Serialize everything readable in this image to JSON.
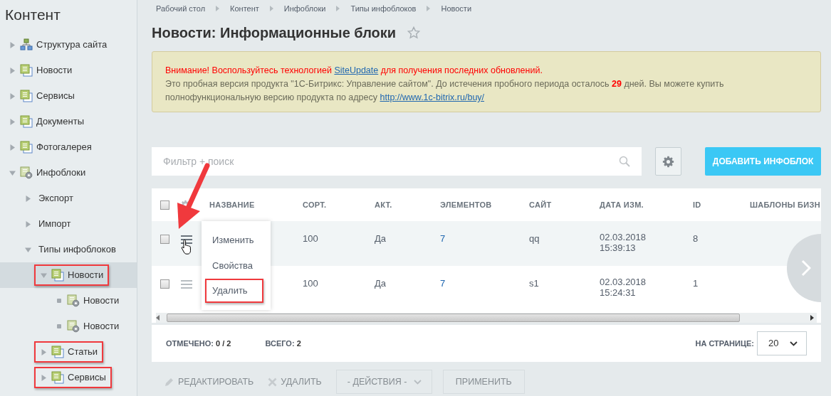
{
  "sidebar": {
    "title": "Контент",
    "items": [
      {
        "label": "Структура сайта",
        "kind": "structure",
        "expanded": false,
        "selected": false,
        "annotated": false
      },
      {
        "label": "Новости",
        "kind": "iblock",
        "expanded": false,
        "selected": false,
        "annotated": false
      },
      {
        "label": "Сервисы",
        "kind": "iblock",
        "expanded": false,
        "selected": false,
        "annotated": false
      },
      {
        "label": "Документы",
        "kind": "iblock",
        "expanded": false,
        "selected": false,
        "annotated": false
      },
      {
        "label": "Фотогалерея",
        "kind": "iblock",
        "expanded": false,
        "selected": false,
        "annotated": false
      },
      {
        "label": "Инфоблоки",
        "kind": "iblock-settings",
        "expanded": true,
        "selected": false,
        "annotated": false,
        "children": [
          {
            "label": "Экспорт",
            "kind": "plain",
            "expanded": false,
            "selected": false,
            "annotated": false
          },
          {
            "label": "Импорт",
            "kind": "plain",
            "expanded": false,
            "selected": false,
            "annotated": false
          },
          {
            "label": "Типы инфоблоков",
            "kind": "plain",
            "expanded": true,
            "selected": false,
            "annotated": false,
            "children": [
              {
                "label": "Новости",
                "kind": "iblock",
                "expanded": true,
                "selected": true,
                "annotated": true,
                "children": [
                  {
                    "label": "Новости",
                    "kind": "iblock-settings",
                    "selected": false,
                    "annotated": false
                  },
                  {
                    "label": "Новости",
                    "kind": "iblock-settings",
                    "selected": false,
                    "annotated": false
                  }
                ]
              },
              {
                "label": "Статьи",
                "kind": "iblock",
                "expanded": false,
                "selected": false,
                "annotated": true
              },
              {
                "label": "Сервисы",
                "kind": "iblock",
                "expanded": false,
                "selected": false,
                "annotated": true
              }
            ]
          }
        ]
      }
    ]
  },
  "breadcrumbs": [
    "Рабочий стол",
    "Контент",
    "Инфоблоки",
    "Типы инфоблоков",
    "Новости"
  ],
  "page_title": "Новости: Информационные блоки",
  "favorite": false,
  "notice": {
    "warning_before": "Внимание! Воспользуйтесь технологией ",
    "warning_link": "SiteUpdate",
    "warning_after": " для получения последних обновлений.",
    "trial_text": "Это пробная версия продукта \"1С-Битрикс: Управление сайтом\". До истечения пробного периода осталось **29** дней. Вы можете купить полнофункциональную версию продукта по адресу ",
    "trial_link": "http://www.1c-bitrix.ru/buy/"
  },
  "search": {
    "placeholder": "Фильтр + поиск"
  },
  "add_button": "ДОБАВИТЬ ИНФОБЛОК",
  "table": {
    "all_checked": false,
    "columns": [
      "НАЗВАНИЕ",
      "СОРТ.",
      "АКТ.",
      "ЭЛЕМЕНТОВ",
      "САЙТ",
      "ДАТА ИЗМ.",
      "ID",
      "ШАБЛОНЫ БИЗН"
    ],
    "rows": [
      {
        "checked": false,
        "hovered": true,
        "sort": "100",
        "active": "Да",
        "elements": "7",
        "site": "qq",
        "date": "02.03.2018 15:39:13",
        "id": "8"
      },
      {
        "checked": false,
        "hovered": false,
        "sort": "100",
        "active": "Да",
        "elements": "7",
        "site": "s1",
        "date": "02.03.2018 15:24:31",
        "id": "1"
      }
    ]
  },
  "context_menu": [
    {
      "label": "Изменить",
      "annotated": false
    },
    {
      "label": "Свойства",
      "annotated": false
    },
    {
      "label": "Удалить",
      "annotated": true
    }
  ],
  "footer": {
    "checked": "ОТМЕЧЕНО: **0 / 2**",
    "total": "ВСЕГО: **2**",
    "per_page_label": "НА СТРАНИЦЕ:",
    "per_page": "20"
  },
  "actions": [
    {
      "kind": "edit",
      "label": "РЕДАКТИРОВАТЬ",
      "disabled": true
    },
    {
      "kind": "delete",
      "label": "УДАЛИТЬ",
      "disabled": true
    },
    {
      "kind": "select",
      "label": "- ДЕЙСТВИЯ -",
      "disabled": true
    },
    {
      "kind": "outline",
      "label": "ПРИМЕНИТЬ",
      "disabled": true
    }
  ]
}
